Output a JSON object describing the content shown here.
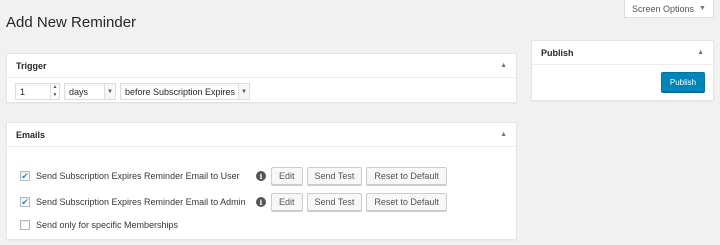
{
  "screen_options": {
    "label": "Screen Options",
    "caret": "▼"
  },
  "page": {
    "title": "Add New Reminder"
  },
  "trigger": {
    "heading": "Trigger",
    "toggle": "▲",
    "number_value": "1",
    "unit_value": "days",
    "relation_value": "before Subscription Expires"
  },
  "emails": {
    "heading": "Emails",
    "toggle": "▲",
    "rows": [
      {
        "label": "Send Subscription Expires Reminder Email to User",
        "checked": true
      },
      {
        "label": "Send Subscription Expires Reminder Email to Admin",
        "checked": true
      },
      {
        "label": "Send only for specific Memberships",
        "checked": false
      }
    ],
    "buttons": {
      "edit": "Edit",
      "send_test": "Send Test",
      "reset": "Reset to Default"
    },
    "info_glyph": "i",
    "check_glyph": "✔"
  },
  "publish": {
    "heading": "Publish",
    "toggle": "▲",
    "button_label": "Publish"
  },
  "colors": {
    "accent": "#0085ba",
    "background": "#f1f1f1",
    "checkmark": "#1e8cbe"
  },
  "icons": {
    "spinner_up": "▲",
    "spinner_down": "▼",
    "select_arrow": "▼"
  }
}
